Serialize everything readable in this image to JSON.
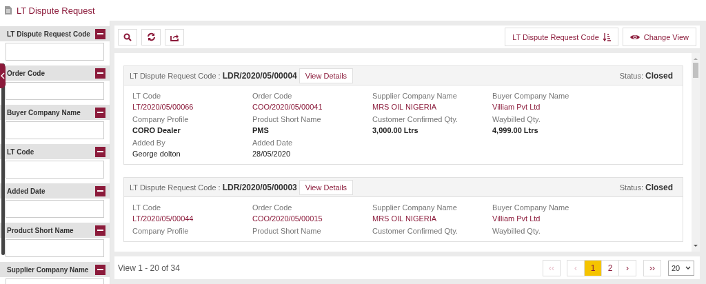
{
  "page": {
    "title": "LT Dispute Request"
  },
  "filters": [
    {
      "label": "LT Dispute Request Code"
    },
    {
      "label": "Order Code"
    },
    {
      "label": "Buyer Company Name"
    },
    {
      "label": "LT Code"
    },
    {
      "label": "Added Date"
    },
    {
      "label": "Product Short Name"
    },
    {
      "label": "Supplier Company Name"
    }
  ],
  "toolbar": {
    "sort_button": "LT Dispute Request Code",
    "view_button": "Change View"
  },
  "records": [
    {
      "code_label": "LT Dispute Request Code :",
      "code": "LDR/2020/05/00004",
      "details_button": "View Details",
      "status_label": "Status:",
      "status": "Closed",
      "fields": [
        {
          "label": "LT Code",
          "value": "LT/2020/05/00066",
          "kind": "link"
        },
        {
          "label": "Order Code",
          "value": "COO/2020/05/00041",
          "kind": "link"
        },
        {
          "label": "Supplier Company Name",
          "value": "MRS OIL NIGERIA",
          "kind": "link"
        },
        {
          "label": "Buyer Company Name",
          "value": "Villiam Pvt Ltd",
          "kind": "link"
        },
        {
          "label": "Company Profile",
          "value": "CORO Dealer",
          "kind": "text"
        },
        {
          "label": "Product Short Name",
          "value": "PMS",
          "kind": "text"
        },
        {
          "label": "Customer Confirmed Qty.",
          "value": "3,000.00 Ltrs",
          "kind": "text"
        },
        {
          "label": "Waybilled Qty.",
          "value": "4,999.00 Ltrs",
          "kind": "text"
        },
        {
          "label": "Added By",
          "value": "George dolton",
          "kind": "plain"
        },
        {
          "label": "Added Date",
          "value": "28/05/2020",
          "kind": "plain"
        }
      ]
    },
    {
      "code_label": "LT Dispute Request Code :",
      "code": "LDR/2020/05/00003",
      "details_button": "View Details",
      "status_label": "Status:",
      "status": "Closed",
      "fields": [
        {
          "label": "LT Code",
          "value": "LT/2020/05/00044",
          "kind": "link"
        },
        {
          "label": "Order Code",
          "value": "COO/2020/05/00015",
          "kind": "link"
        },
        {
          "label": "Supplier Company Name",
          "value": "MRS OIL NIGERIA",
          "kind": "link"
        },
        {
          "label": "Buyer Company Name",
          "value": "Villiam Pvt Ltd",
          "kind": "link"
        },
        {
          "label": "Company Profile"
        },
        {
          "label": "Product Short Name"
        },
        {
          "label": "Customer Confirmed Qty."
        },
        {
          "label": "Waybilled Qty."
        }
      ]
    }
  ],
  "footer": {
    "summary": "View 1 - 20 of 34",
    "nav": [
      {
        "label": "‹‹",
        "kind": "first",
        "disabled": true
      },
      {
        "label": "‹",
        "kind": "prev",
        "disabled": true
      }
    ],
    "pages": [
      {
        "label": "1",
        "selected": true
      },
      {
        "label": "2",
        "selected": false
      }
    ],
    "nav_after": [
      {
        "label": "›",
        "kind": "next",
        "disabled": false
      },
      {
        "label": "››",
        "kind": "last",
        "disabled": false
      }
    ],
    "page_size": "20"
  }
}
